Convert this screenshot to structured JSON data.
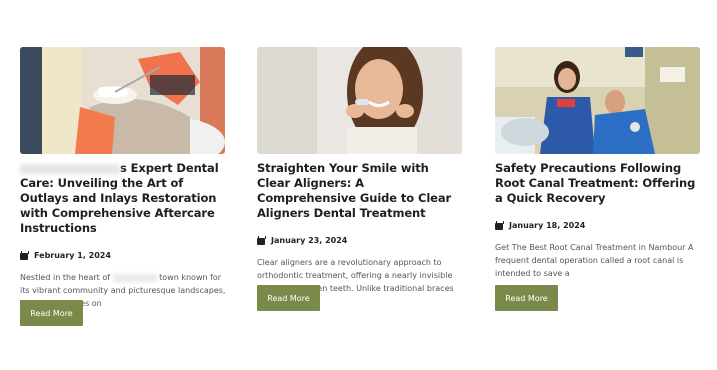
{
  "posts": [
    {
      "title_pre": "",
      "title": "s Expert Dental Care: Unveiling the Art of Outlays and Inlays Restoration with Comprehensive Aftercare Instructions",
      "date": "February 1, 2024",
      "excerpt_a": "Nestled in the heart of",
      "excerpt_b": "town known for its vibrant community and picturesque landscapes, dental care takes on",
      "button": "Read More",
      "image_icon": "dental-procedure-photo"
    },
    {
      "title": "Straighten Your Smile with Clear Aligners: A Comprehensive Guide to Clear Aligners Dental Treatment",
      "date": "January 23, 2024",
      "excerpt": "Clear aligners are a revolutionary approach to orthodontic treatment, offering a nearly invisible way to straighten teeth. Unlike traditional braces",
      "button": "Read More",
      "image_icon": "woman-holding-aligner-photo"
    },
    {
      "title": "Safety Precautions Following Root Canal Treatment: Offering a Quick Recovery",
      "date": "January 18, 2024",
      "excerpt": "Get The Best Root Canal Treatment in Nambour A frequent dental operation called a root canal is intended to save a",
      "button": "Read More",
      "image_icon": "dentist-with-patient-photo"
    }
  ],
  "colors": {
    "button_bg": "#7a8a4a",
    "title": "#1f1f1f",
    "excerpt": "#555555"
  }
}
